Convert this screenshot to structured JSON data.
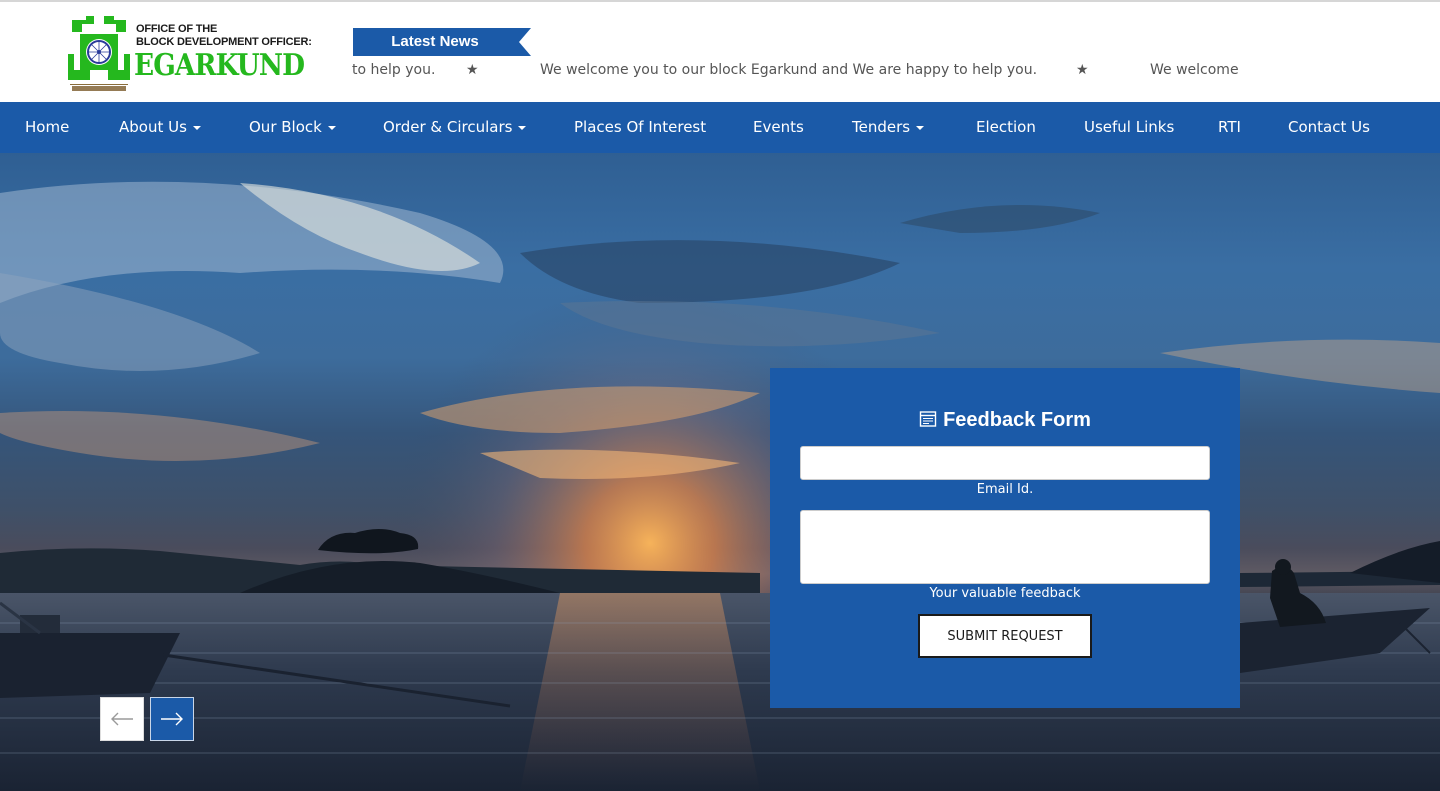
{
  "header": {
    "logo": {
      "line1": "OFFICE OF THE",
      "line2": "BLOCK DEVELOPMENT OFFICER:",
      "name": "EGARKUND",
      "seal_text": "झारखण्ड सरकार"
    },
    "news": {
      "label": "Latest News",
      "ticker": [
        "to help you.",
        "We welcome you to our block Egarkund and We are happy to help you.",
        "We welcome"
      ]
    }
  },
  "nav": {
    "items": [
      {
        "label": "Home"
      },
      {
        "label": "About Us"
      },
      {
        "label": "Our Block"
      },
      {
        "label": "Order & Circulars"
      },
      {
        "label": "Places Of Interest"
      },
      {
        "label": "Events"
      },
      {
        "label": "Tenders"
      },
      {
        "label": "Election"
      },
      {
        "label": "Useful Links"
      },
      {
        "label": "RTI"
      },
      {
        "label": "Contact Us"
      }
    ]
  },
  "feedback": {
    "title": "Feedback Form",
    "email_label": "Email Id.",
    "email_value": "",
    "message_label": "Your valuable feedback",
    "message_value": "",
    "submit_label": "SUBMIT REQUEST"
  },
  "slider": {
    "prev_icon": "arrow-left-icon",
    "next_icon": "arrow-right-icon"
  },
  "colors": {
    "brand_blue": "#1b5aa8",
    "logo_green": "#25b81e",
    "ticker_text": "#555555"
  }
}
